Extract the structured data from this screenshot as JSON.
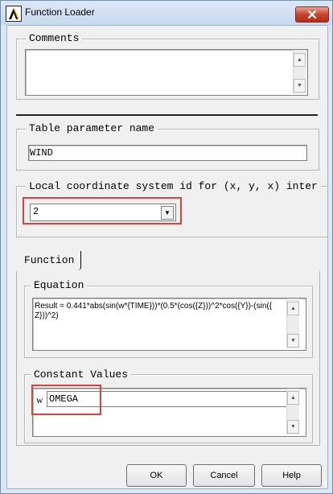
{
  "window": {
    "title": "Function Loader"
  },
  "comments": {
    "legend": "Comments",
    "value": ""
  },
  "table_param": {
    "legend": "Table parameter name",
    "value": "WIND"
  },
  "coord_system": {
    "legend": "Local coordinate system id for (x, y, x) inter",
    "selected": "2"
  },
  "tab": {
    "label": "Function"
  },
  "equation": {
    "legend": "Equation",
    "line1": "Result = 0.441*abs(sin(w*{TIME}))*(0.5*(cos({Z}))^2*cos({Y})-(sin({",
    "line2": "Z}))^2)"
  },
  "constants": {
    "legend": "Constant Values",
    "label": "w",
    "value": "OMEGA"
  },
  "buttons": {
    "ok": "OK",
    "cancel": "Cancel",
    "help": "Help"
  },
  "colors": {
    "highlight": "#e0403b",
    "close_button": "#c7432b"
  },
  "icons": {
    "app": "ansys-logo-icon",
    "close": "close-icon"
  }
}
